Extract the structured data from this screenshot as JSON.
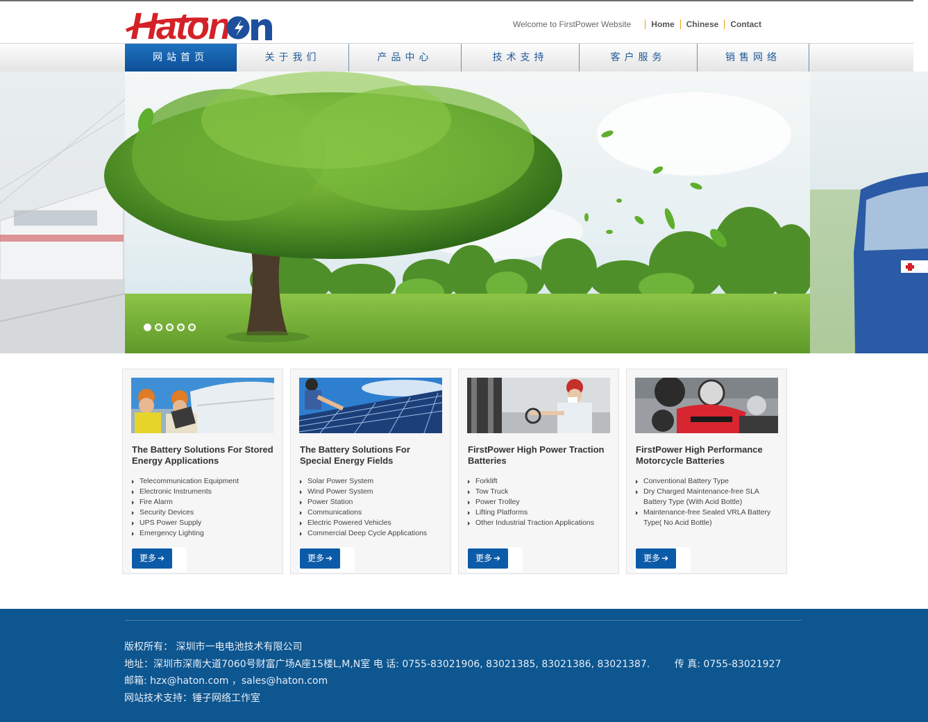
{
  "header": {
    "logo_text": "Haton",
    "welcome": "Welcome to FirstPower Website",
    "links": [
      "Home",
      "Chinese",
      "Contact"
    ]
  },
  "nav": {
    "items": [
      "网站首页",
      "关于我们",
      "产品中心",
      "技术支持",
      "客户服务",
      "销售网络"
    ],
    "active_index": 0
  },
  "banner": {
    "slides": 5,
    "current": 1
  },
  "cards": [
    {
      "title": "The Battery Solutions For Stored Energy Applications",
      "items": [
        "Telecommunication Equipment",
        "Electronic Instruments",
        "Fire Alarm",
        "Security Devices",
        "UPS Power Supply",
        "Emergency Lighting"
      ],
      "more": "更多"
    },
    {
      "title": "The Battery Solutions For Special Energy Fields",
      "items": [
        "Solar Power System",
        "Wind Power System",
        "Power Station",
        "Communications",
        "Electric Powered Vehicles",
        "Commercial Deep Cycle Applications"
      ],
      "more": "更多"
    },
    {
      "title": "FirstPower High Power Traction Batteries",
      "items": [
        "Forklift",
        "Tow Truck",
        "Power Trolley",
        "Lifting Platforms",
        "Other Industrial Traction Applications"
      ],
      "more": "更多"
    },
    {
      "title": "FirstPower High Performance Motorcycle Batteries",
      "items": [
        "Conventional Battery Type",
        "Dry Charged Maintenance-free SLA Battery Type (With Acid Bottle)",
        "Maintenance-free Sealed VRLA Battery Type( No Acid Bottle)"
      ],
      "more": "更多"
    }
  ],
  "footer": {
    "copyright": "版权所有： 深圳市一电电池技术有限公司",
    "address": "地址：深圳市深南大道7060号财富广场A座15楼L,M,N室 电 话: 0755-83021906, 83021385, 83021386, 83021387.        传 真: 0755-83021927",
    "email": "邮箱: hzx@haton.com ，sales@haton.com",
    "support": "网站技术支持：锤子网络工作室"
  },
  "colors": {
    "brand_red": "#d42127",
    "brand_blue": "#1d4f9c",
    "nav_active": "#0d4f95",
    "footer_bg": "#0d5690",
    "more_button": "#0b5ba8"
  }
}
